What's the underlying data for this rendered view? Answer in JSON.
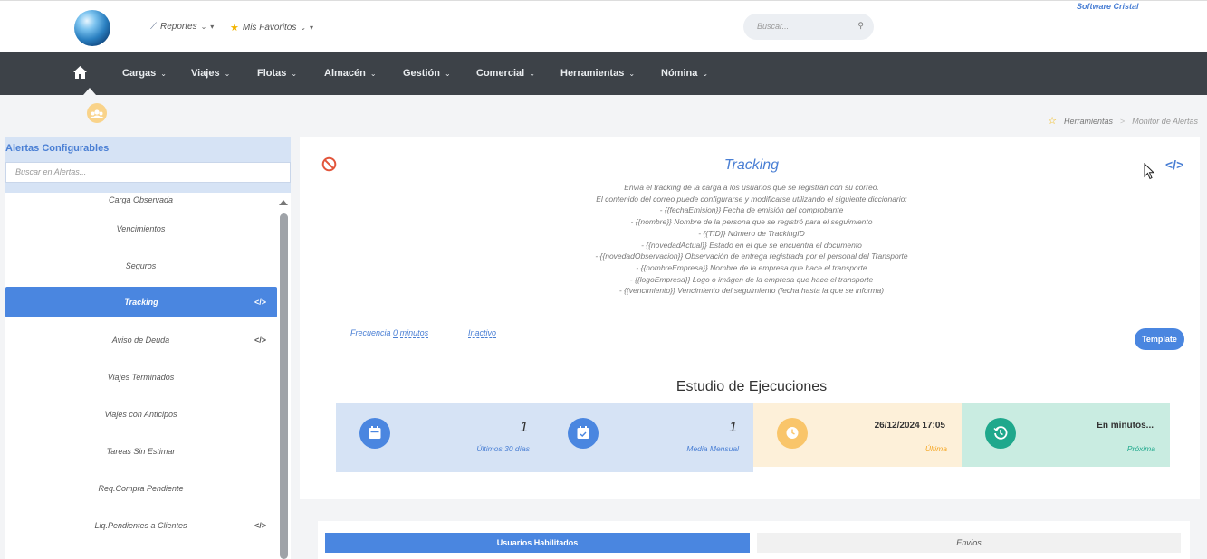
{
  "header": {
    "reportes_label": "Reportes",
    "favoritos_label": "Mis Favoritos",
    "search_placeholder": "Buscar...",
    "brand": "Software Cristal"
  },
  "nav": {
    "items": [
      "Cargas",
      "Viajes",
      "Flotas",
      "Almacén",
      "Gestión",
      "Comercial",
      "Herramientas",
      "Nómina"
    ]
  },
  "breadcrumb": {
    "parent": "Herramientas",
    "current": "Monitor de Alertas"
  },
  "sidebar": {
    "title": "Alertas Configurables",
    "search_placeholder": "Buscar en Alertas...",
    "items": [
      {
        "label": "Carga Observada"
      },
      {
        "label": "Vencimientos"
      },
      {
        "label": "Seguros"
      },
      {
        "label": "Tracking",
        "code": "</>"
      },
      {
        "label": "Aviso de Deuda",
        "code": "</>"
      },
      {
        "label": "Viajes Terminados"
      },
      {
        "label": "Viajes con Anticipos"
      },
      {
        "label": "Tareas Sin Estimar"
      },
      {
        "label": "Req.Compra Pendiente"
      },
      {
        "label": "Liq.Pendientes a Clientes",
        "code": "</>"
      }
    ]
  },
  "detail": {
    "title": "Tracking",
    "code_label": "</>",
    "description": [
      "Envía el tracking de la carga a los usuarios que se registran con su correo.",
      "El contenido del correo puede configurarse y modificarse utilizando el siguiente diccionario:",
      "- {{fechaEmision}} Fecha de emisión del comprobante",
      "- {{nombre}} Nombre de la persona que se registró para el seguimiento",
      "- {{TID}} Número de TrackingID",
      "- {{novedadActual}} Estado en el que se encuentra el documento",
      "- {{novedadObservacion}} Observación de entrega registrada por el personal del Transporte",
      "- {{nombreEmpresa}} Nombre de la empresa que hace el transporte",
      "- {{logoEmpresa}} Logo o imágen de la empresa que hace el transporte",
      "- {{vencimiento}} Vencimiento del seguimiento (fecha hasta la que se informa)"
    ],
    "frequency_prefix": "Frecuencia",
    "frequency_value": "0",
    "frequency_unit": "minutos",
    "status": "Inactivo",
    "template_button": "Template"
  },
  "study": {
    "title": "Estudio de Ejecuciones",
    "stats": [
      {
        "value": "1",
        "label": "Últimos 30 días",
        "icon": "calendar-icon"
      },
      {
        "value": "1",
        "label": "Media Mensual",
        "icon": "calendar-check-icon"
      },
      {
        "value": "26/12/2024 17:05",
        "label": "Última",
        "icon": "clock-icon"
      },
      {
        "value": "En minutos...",
        "label": "Próxima",
        "icon": "history-icon"
      }
    ]
  },
  "tabs": {
    "users": "Usuarios Habilitados",
    "sends": "Envíos"
  }
}
